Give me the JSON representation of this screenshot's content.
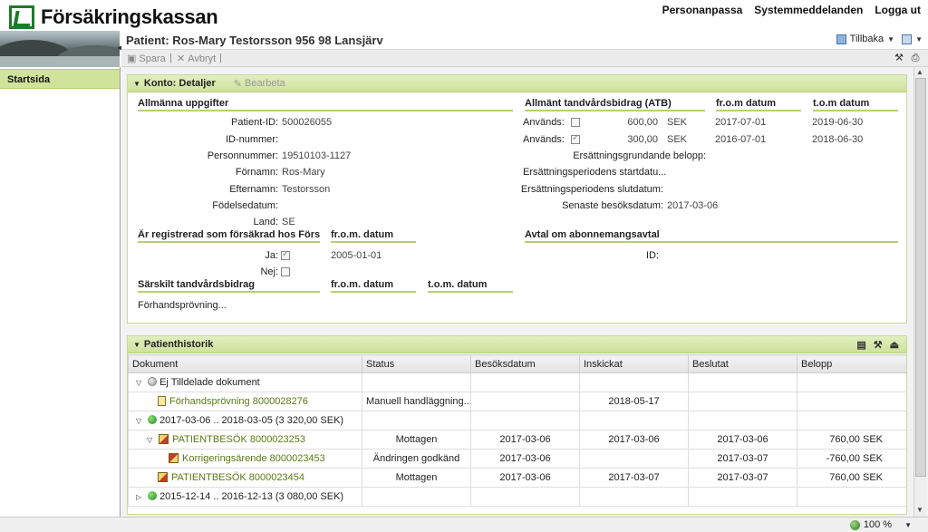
{
  "header": {
    "logo_text": "Försäkringskassan",
    "links": [
      "Personanpassa",
      "Systemmeddelanden",
      "Logga ut"
    ]
  },
  "sidebar": {
    "items": [
      {
        "label": "Startsida"
      }
    ]
  },
  "title": {
    "text": "Patient: Ros-Mary Testorsson 956 98 Lansjärv",
    "back_label": "Tillbaka"
  },
  "toolbar": {
    "save_label": "Spara",
    "cancel_label": "Avbryt"
  },
  "konto": {
    "title": "Konto: Detaljer",
    "edit_label": "Bearbeta",
    "general_section": "Allmänna uppgifter",
    "fields": [
      {
        "label": "Patient-ID:",
        "value": "500026055"
      },
      {
        "label": "ID-nummer:",
        "value": ""
      },
      {
        "label": "Personnummer:",
        "value": "19510103-1127"
      },
      {
        "label": "Förnamn:",
        "value": "Ros-Mary"
      },
      {
        "label": "Efternamn:",
        "value": "Testorsson"
      },
      {
        "label": "Födelsedatum:",
        "value": ""
      },
      {
        "label": "Land:",
        "value": "SE"
      }
    ],
    "atb_section": "Allmänt tandvårdsbidrag (ATB)",
    "from_header": "fr.o.m datum",
    "to_header": "t.o.m datum",
    "atb_rows": [
      {
        "label": "Används:",
        "checked": false,
        "amount": "600,00",
        "currency": "SEK",
        "from": "2017-07-01",
        "to": "2019-06-30"
      },
      {
        "label": "Används:",
        "checked": true,
        "amount": "300,00",
        "currency": "SEK",
        "from": "2016-07-01",
        "to": "2018-06-30"
      }
    ],
    "basis_label": "Ersättningsgrundande belopp:",
    "period_start_label": "Ersättningsperiodens startdatu...",
    "period_end_label": "Ersättningsperiodens slutdatum:",
    "last_visit_label": "Senaste besöksdatum:",
    "last_visit_value": "2017-03-06",
    "insured_section": "Är registrerad som försäkrad hos Förs...",
    "insured_from_header": "fr.o.m. datum",
    "yes_label": "Ja:",
    "yes_date": "2005-01-01",
    "no_label": "Nej:",
    "subscription_section": "Avtal om abonnemangsavtal",
    "subscription_id_label": "ID:",
    "special_section": "Särskilt tandvårdsbidrag",
    "special_from_header": "fr.o.m. datum",
    "special_to_header": "t.o.m. datum",
    "prior_review_label": "Förhandsprövning..."
  },
  "history": {
    "title": "Patienthistorik",
    "columns": [
      "Dokument",
      "Status",
      "Besöksdatum",
      "Inskickat",
      "Beslutat",
      "Belopp"
    ],
    "rows": [
      {
        "doc": "Ej Tilldelade dokument",
        "status": "",
        "visit": "",
        "sent": "",
        "decided": "",
        "amount": ""
      },
      {
        "doc": "Förhandsprövning 8000028276",
        "status": "Manuell handläggning...",
        "visit": "",
        "sent": "2018-05-17",
        "decided": "",
        "amount": ""
      },
      {
        "doc": "2017-03-06 .. 2018-03-05 (3 320,00 SEK)",
        "status": "",
        "visit": "",
        "sent": "",
        "decided": "",
        "amount": ""
      },
      {
        "doc": "PATIENTBESÖK 8000023253",
        "status": "Mottagen",
        "visit": "2017-03-06",
        "sent": "2017-03-06",
        "decided": "2017-03-06",
        "amount": "760,00 SEK"
      },
      {
        "doc": "Korrigeringsärende 8000023453",
        "status": "Ändringen godkänd",
        "visit": "2017-03-06",
        "sent": "",
        "decided": "2017-03-07",
        "amount": "-760,00 SEK"
      },
      {
        "doc": "PATIENTBESÖK 8000023454",
        "status": "Mottagen",
        "visit": "2017-03-06",
        "sent": "2017-03-07",
        "decided": "2017-03-07",
        "amount": "760,00 SEK"
      },
      {
        "doc": "2015-12-14 .. 2016-12-13 (3 080,00 SEK)",
        "status": "",
        "visit": "",
        "sent": "",
        "decided": "",
        "amount": ""
      }
    ]
  },
  "statusbar": {
    "zoom": "100 %"
  }
}
